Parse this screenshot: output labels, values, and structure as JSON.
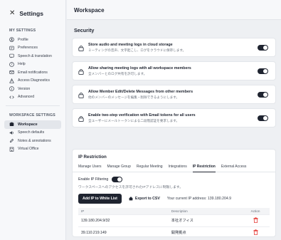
{
  "sidebar": {
    "title": "Settings",
    "my_settings_label": "MY SETTINGS",
    "my_items": [
      {
        "label": "Profile",
        "icon": "user-icon"
      },
      {
        "label": "Preferences",
        "icon": "sliders-icon"
      },
      {
        "label": "Speech & translation",
        "icon": "speech-icon"
      },
      {
        "label": "Help",
        "icon": "help-icon"
      },
      {
        "label": "Email notifications",
        "icon": "mail-icon"
      },
      {
        "label": "Access Diagnostics",
        "icon": "diagnostics-icon"
      },
      {
        "label": "Version",
        "icon": "info-icon"
      },
      {
        "label": "Advanced",
        "icon": "code-icon"
      }
    ],
    "workspace_settings_label": "WORKSPACE SETTINGS",
    "ws_items": [
      {
        "label": "Workspace",
        "icon": "workspace-icon",
        "active": true
      },
      {
        "label": "Speech defaults",
        "icon": "speech-defaults-icon"
      },
      {
        "label": "Notes & annotations",
        "icon": "notes-icon"
      },
      {
        "label": "Virtual Office",
        "icon": "office-icon"
      }
    ]
  },
  "main": {
    "title": "Workspace",
    "security_title": "Security",
    "security_items": [
      {
        "title": "Store audio and meeting logs in cloud storage",
        "subtitle": "ミーティングの音声、文字起こし、ログをクラウドに保存します。",
        "enabled": true
      },
      {
        "title": "Allow sharing meeting logs with all workspace members",
        "subtitle": "全メンバーとのログ共有を許可します。",
        "enabled": true
      },
      {
        "title": "Allow Member Edit/Delete Messages from other members",
        "subtitle": "他のメンバーのメッセージを編集・削除できるようにします。",
        "enabled": true
      },
      {
        "title": "Enable two-step verification with Email tokens for all users",
        "subtitle": "全ユーザーにメールトークンによる二段階認証を要求します。",
        "enabled": true
      }
    ]
  },
  "ip": {
    "title": "IP Restriction",
    "tabs": [
      "Manage Users",
      "Manage Group",
      "Regular Meeting",
      "Integrations",
      "IP Restriction",
      "External Access"
    ],
    "active_tab": "IP Restriction",
    "filter_label": "Enable IP Filtering",
    "filter_enabled": true,
    "note": "ワークスペースへのアクセスを許可されたIPアドレスに制限します。",
    "add_button": "Add IP to White List",
    "export_button": "Export to CSV",
    "current_ip_text": "Your current IP address: 139.180.204.9",
    "columns": [
      "IP",
      "Description",
      "Action"
    ],
    "rows": [
      {
        "ip": "139.180.204.9/32",
        "description": "本社オフィス"
      },
      {
        "ip": "39.110.219.149",
        "description": "開発拠点"
      }
    ]
  },
  "colors": {
    "accent": "#1f2430",
    "danger": "#e53935"
  }
}
